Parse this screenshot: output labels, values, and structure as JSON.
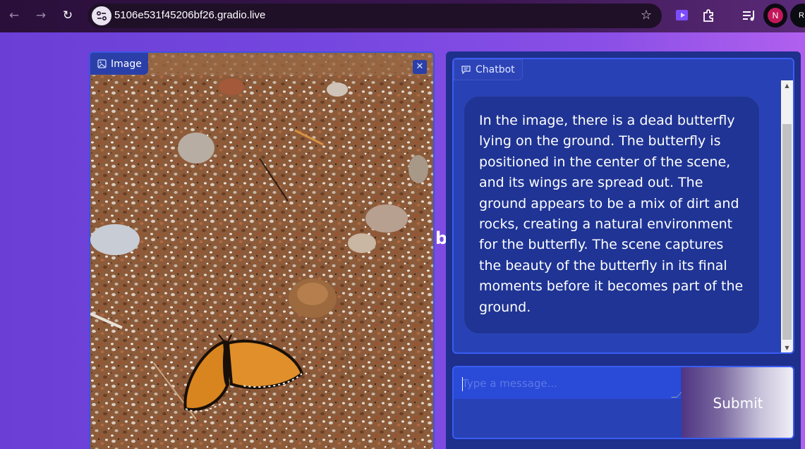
{
  "browser": {
    "url": "5106e531f45206bf26.gradio.live",
    "profile_initial": "N",
    "second_profile_initial": "R",
    "icons": [
      "back-arrow-icon",
      "forward-arrow-icon",
      "reload-icon",
      "site-info-icon",
      "bookmark-star-icon",
      "extension-icon",
      "puzzle-icon",
      "media-control-icon"
    ]
  },
  "image_panel": {
    "label": "Image",
    "close_symbol": "✕",
    "icon": "image-icon",
    "stray_text": "b"
  },
  "chatbot": {
    "label": "Chatbot",
    "icon": "chat-icon",
    "message": "In the image, there is a dead butterfly lying on the ground. The butterfly is positioned in the center of the scene, and its wings are spread out. The ground appears to be a mix of dirt and rocks, creating a natural environment for the butterfly. The scene captures the beauty of the butterfly in its final moments before it becomes part of the ground."
  },
  "input": {
    "placeholder": "Type a message...",
    "submit_label": "Submit"
  },
  "colors": {
    "background_gradient_start": "#6b3fd6",
    "background_gradient_end": "#b060ee",
    "panel_blue": "#2841b5",
    "bubble_blue": "#1f3494",
    "accent_border": "#3a5df0"
  }
}
